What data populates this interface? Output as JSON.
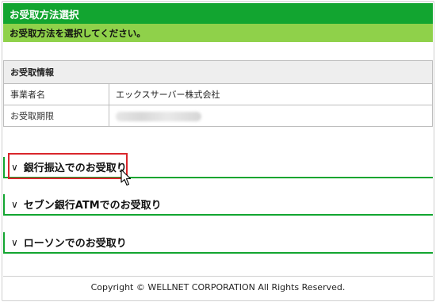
{
  "header": {
    "title": "お受取方法選択",
    "instruction": "お受取方法を選択してください。"
  },
  "info_table": {
    "title": "お受取情報",
    "rows": [
      {
        "label": "事業者名",
        "value": "エックスサーバー株式会社"
      },
      {
        "label": "お受取期限",
        "value": ""
      }
    ]
  },
  "options": [
    {
      "chevron": "∨",
      "label": "銀行振込でのお受取り",
      "highlighted": true
    },
    {
      "chevron": "∨",
      "label": "セブン銀行ATMでのお受取り"
    },
    {
      "chevron": "∨",
      "label": "ローソンでのお受取り"
    }
  ],
  "footer": {
    "copyright": "Copyright © WELLNET CORPORATION All Rights Reserved."
  },
  "colors": {
    "header_green": "#12a530",
    "subheader_green": "#8fd14a",
    "highlight_red": "#d9262c"
  },
  "icons": {
    "cursor": "pointer-cursor-icon"
  }
}
